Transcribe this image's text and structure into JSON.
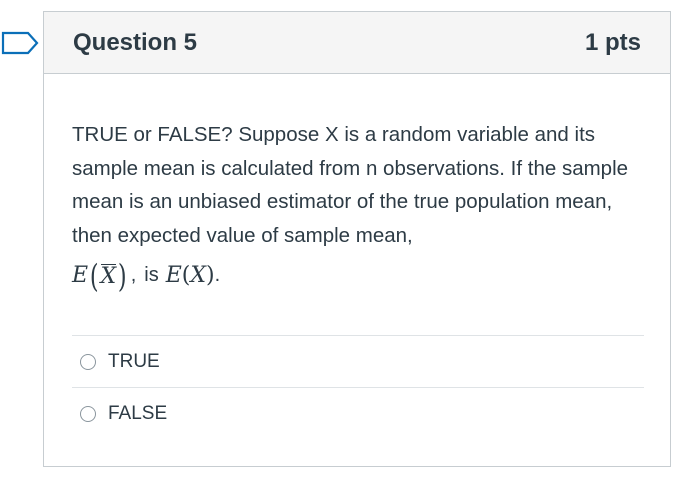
{
  "question": {
    "title": "Question 5",
    "points": "1 pts",
    "text": "TRUE or FALSE? Suppose X is a random variable and its sample mean is calculated from n observations. If the sample mean is an unbiased estimator of the true population mean, then expected value of sample mean,",
    "math": {
      "expected_symbol": "E",
      "open_paren": "(",
      "variable": "X",
      "close_paren": ")",
      "comma": ",",
      "is_word": "is",
      "rhs_expected": "E",
      "rhs_open": "(",
      "rhs_variable": "X",
      "rhs_close": ")",
      "period": "."
    }
  },
  "answers": [
    {
      "label": "TRUE",
      "selected": false
    },
    {
      "label": "FALSE",
      "selected": false
    }
  ],
  "flag_icon": "bookmark-flag-icon",
  "colors": {
    "accent": "#0b6fb8",
    "text": "#2d3b45",
    "border": "#c7cdd1",
    "header_bg": "#f5f5f5"
  }
}
